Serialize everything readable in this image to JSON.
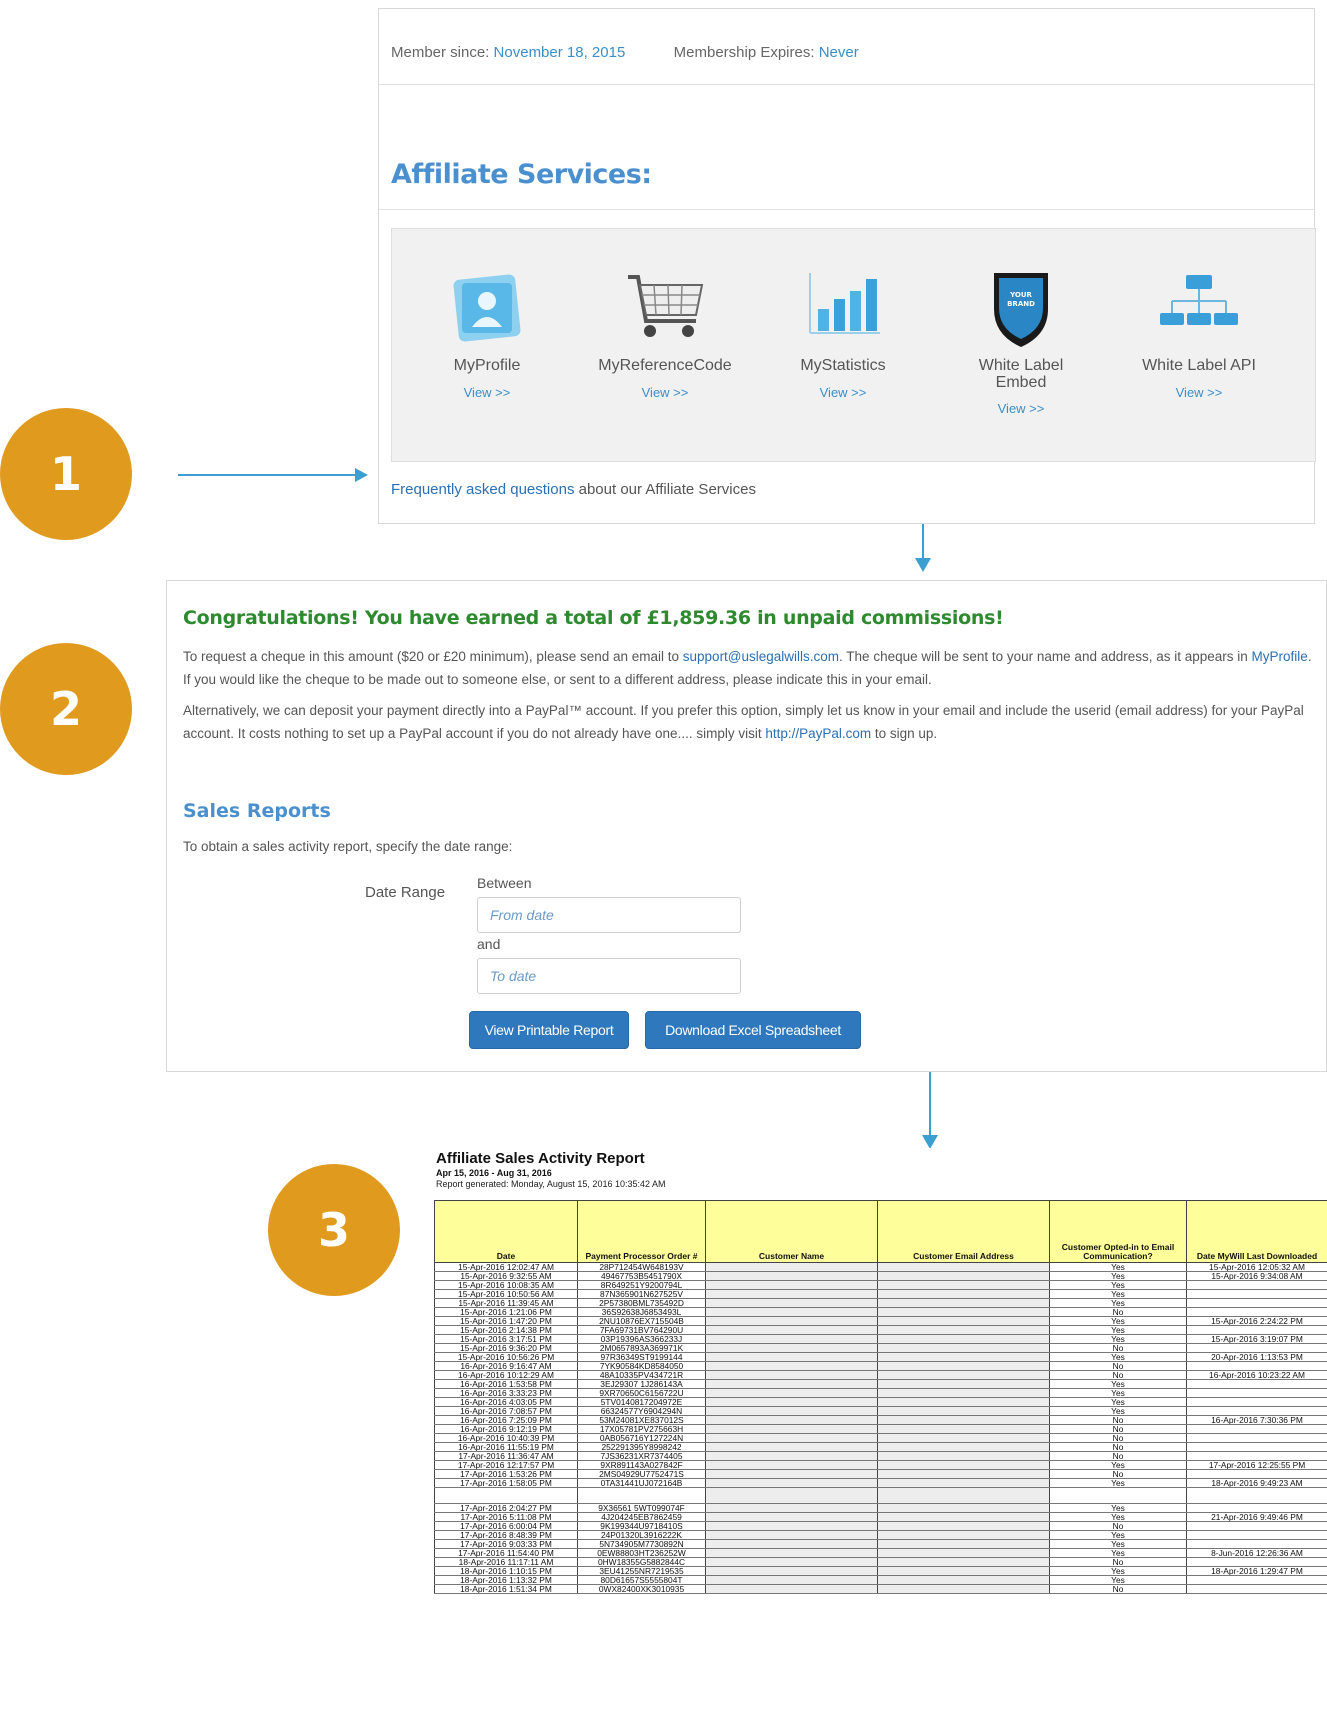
{
  "steps": [
    "1",
    "2",
    "3"
  ],
  "panel1": {
    "member_since_label": "Member since:",
    "member_since_value": "November 18, 2015",
    "expires_label": "Membership Expires:",
    "expires_value": "Never",
    "title": "Affiliate Services:",
    "services": [
      {
        "name": "MyProfile",
        "view": "View >>",
        "icon": "profile-icon"
      },
      {
        "name": "MyReferenceCode",
        "view": "View >>",
        "icon": "shopping-cart-icon"
      },
      {
        "name": "MyStatistics",
        "view": "View >>",
        "icon": "bar-chart-icon"
      },
      {
        "name": "White Label\nEmbed",
        "view": "View >>",
        "icon": "shield-brand-icon"
      },
      {
        "name": "White Label API",
        "view": "View >>",
        "icon": "network-icon"
      }
    ],
    "shield_text": "YOUR\nBRAND",
    "faq_link": "Frequently asked questions",
    "faq_rest": "about our Affiliate Services"
  },
  "panel2": {
    "congrats": "Congratulations! You have earned a total of £1,859.36 in unpaid commissions!",
    "para1_a": "To request a cheque in this amount ($20 or £20 minimum), please send an email to ",
    "para1_email": "support@uslegalwills.com",
    "para1_b": ". The cheque will be sent to your name and address, as it appears in ",
    "para1_profile": "MyProfile",
    "para1_c": ".  If you would like the cheque to be made out to someone else, or sent to a different address, please indicate this in your email.",
    "para2_a": "Alternatively, we can deposit your payment directly into a PayPal™ account.  If you prefer this option, simply let us know in your email and include the userid (email address) for your PayPal account.  It costs nothing to set up a PayPal account if you do not already have one.... simply visit ",
    "para2_link": "http://PayPal.com",
    "para2_b": " to sign up.",
    "sales_title": "Sales Reports",
    "sales_sub": "To obtain a sales activity report, specify the date range:",
    "date_range_label": "Date Range",
    "between": "Between",
    "and": "and",
    "from_placeholder": "From date",
    "to_placeholder": "To date",
    "btn_printable": "View Printable Report",
    "btn_excel": "Download Excel Spreadsheet"
  },
  "report": {
    "title": "Affiliate Sales Activity Report",
    "range": "Apr 15, 2016 - Aug 31, 2016",
    "generated": "Report generated: Monday, August 15, 2016 10:35:42 AM",
    "columns": [
      "Date",
      "Payment Processor Order #",
      "Customer Name",
      "Customer Email Address",
      "Customer Opted-in to Email Communication?",
      "Date MyWill Last Downloaded"
    ],
    "rows": [
      [
        "15-Apr-2016 12:02:47 AM",
        "28P712454W648193V",
        "Yes",
        "15-Apr-2016 12:05:32 AM"
      ],
      [
        "15-Apr-2016 9:32:55 AM",
        "49467753B5451790X",
        "Yes",
        "15-Apr-2016 9:34:08 AM"
      ],
      [
        "15-Apr-2016 10:08:35 AM",
        "8R649251Y9200794L",
        "Yes",
        ""
      ],
      [
        "15-Apr-2016 10:50:56 AM",
        "87N365901N627525V",
        "Yes",
        ""
      ],
      [
        "15-Apr-2016 11:39:45 AM",
        "2P57380BML735492D",
        "Yes",
        ""
      ],
      [
        "15-Apr-2016 1:21:06 PM",
        "36S92638J6853493L",
        "No",
        ""
      ],
      [
        "15-Apr-2016 1:47:20 PM",
        "2NU10876EX715504B",
        "Yes",
        "15-Apr-2016 2:24:22 PM"
      ],
      [
        "15-Apr-2016 2:14:38 PM",
        "7FA69731BV764290U",
        "Yes",
        ""
      ],
      [
        "15-Apr-2016 3:17:51 PM",
        "03P19396AS366233J",
        "Yes",
        "15-Apr-2016 3:19:07 PM"
      ],
      [
        "15-Apr-2016 9:36:20 PM",
        "2M0657893A369971K",
        "No",
        ""
      ],
      [
        "15-Apr-2016 10:56:26 PM",
        "97R36349ST9199144",
        "Yes",
        "20-Apr-2016 1:13:53 PM"
      ],
      [
        "16-Apr-2016 9:16:47 AM",
        "7YK90584KD8584050",
        "No",
        ""
      ],
      [
        "16-Apr-2016 10:12:29 AM",
        "48A10335PV434721R",
        "No",
        "16-Apr-2016 10:23:22 AM"
      ],
      [
        "16-Apr-2016 1:53:58 PM",
        "3EJ29307 1J286143A",
        "Yes",
        ""
      ],
      [
        "16-Apr-2016 3:33:23 PM",
        "9XR70650C6156722U",
        "Yes",
        ""
      ],
      [
        "16-Apr-2016 4:03:05 PM",
        "5TV0140817204972E",
        "Yes",
        ""
      ],
      [
        "16-Apr-2016 7:08:57 PM",
        "66324577Y6904294N",
        "Yes",
        ""
      ],
      [
        "16-Apr-2016 7:25:09 PM",
        "53M24081XE837012S",
        "No",
        "16-Apr-2016 7:30:36 PM"
      ],
      [
        "16-Apr-2016 9:12:19 PM",
        "17X05781PV275663H",
        "No",
        ""
      ],
      [
        "16-Apr-2016 10:40:39 PM",
        "0AB056716Y127224N",
        "No",
        ""
      ],
      [
        "16-Apr-2016 11:55:19 PM",
        "252291395Y8998242",
        "No",
        ""
      ],
      [
        "17-Apr-2016 11:36:47 AM",
        "7JS36231XR7374405",
        "No",
        ""
      ],
      [
        "17-Apr-2016 12:17:57 PM",
        "9XR891143A027842F",
        "Yes",
        "17-Apr-2016 12:25:55 PM"
      ],
      [
        "17-Apr-2016 1:53:26 PM",
        "2MS04929U7752471S",
        "No",
        ""
      ],
      [
        "17-Apr-2016 1:58:05 PM",
        "0TA31441UJ072164B",
        "Yes",
        "18-Apr-2016 9:49:23 AM"
      ],
      [
        "",
        "",
        "",
        ""
      ],
      [
        "17-Apr-2016 2:04:27 PM",
        "9X36561 5WT099074F",
        "Yes",
        ""
      ],
      [
        "17-Apr-2016 5:11:08 PM",
        "4J204245EB7862459",
        "Yes",
        "21-Apr-2016 9:49:46 PM"
      ],
      [
        "17-Apr-2016 6:00:04 PM",
        "9K199344U9718410S",
        "No",
        ""
      ],
      [
        "17-Apr-2016 8:48:39 PM",
        "24P01320L3916222K",
        "Yes",
        ""
      ],
      [
        "17-Apr-2016 9:03:33 PM",
        "5N734905M7730892N",
        "Yes",
        ""
      ],
      [
        "17-Apr-2016 11:54:40 PM",
        "0EW88803HT236252W",
        "Yes",
        "8-Jun-2016 12:26:36 AM"
      ],
      [
        "18-Apr-2016 11:17:11 AM",
        "0HW18355G5882844C",
        "No",
        ""
      ],
      [
        "18-Apr-2016 1:10:15 PM",
        "3EU41255NR7219535",
        "Yes",
        "18-Apr-2016 1:29:47 PM"
      ],
      [
        "18-Apr-2016 1:13:32 PM",
        "80D61657S5555804T",
        "Yes",
        ""
      ],
      [
        "18-Apr-2016 1:51:34 PM",
        "0WX82400XK3010935",
        "No",
        ""
      ]
    ]
  }
}
